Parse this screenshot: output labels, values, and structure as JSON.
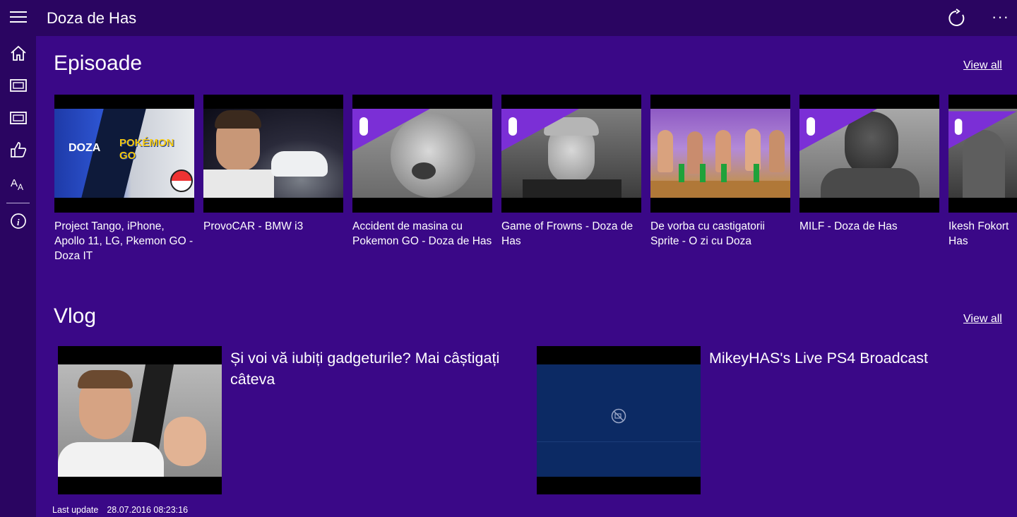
{
  "app": {
    "title": "Doza de Has"
  },
  "sections": {
    "episodes": {
      "title": "Episoade",
      "view_all": "View all",
      "items": [
        {
          "title": "Project Tango, iPhone, Apollo 11, LG, Pkemon GO - Doza IT",
          "thumb_logo": "DOZA",
          "thumb_text": "POKÉMON GO"
        },
        {
          "title": "ProvoCAR - BMW i3"
        },
        {
          "title": "Accident de masina cu Pokemon GO - Doza de Has"
        },
        {
          "title": "Game of Frowns - Doza de Has"
        },
        {
          "title": "De vorba cu castigatorii Sprite - O zi cu Doza"
        },
        {
          "title": "MILF - Doza de Has"
        },
        {
          "title": "Ikesh Fokort Has"
        }
      ]
    },
    "vlog": {
      "title": "Vlog",
      "view_all": "View all",
      "items": [
        {
          "title": "Și voi vă iubiți gadgeturile? Mai câștigați câteva"
        },
        {
          "title": "MikeyHAS's Live PS4 Broadcast"
        }
      ]
    }
  },
  "footer": {
    "label": "Last update",
    "value": "28.07.2016 08:23:16"
  },
  "icons": {
    "menu": "hamburger-icon",
    "refresh": "refresh-icon",
    "more": "more-icon",
    "nav": [
      "home-icon",
      "video-icon",
      "video-icon",
      "like-icon",
      "language-icon",
      "info-icon"
    ]
  },
  "colors": {
    "background": "#3a0887",
    "chrome": "#2a0561",
    "accent_purple": "#7b2fd6"
  }
}
